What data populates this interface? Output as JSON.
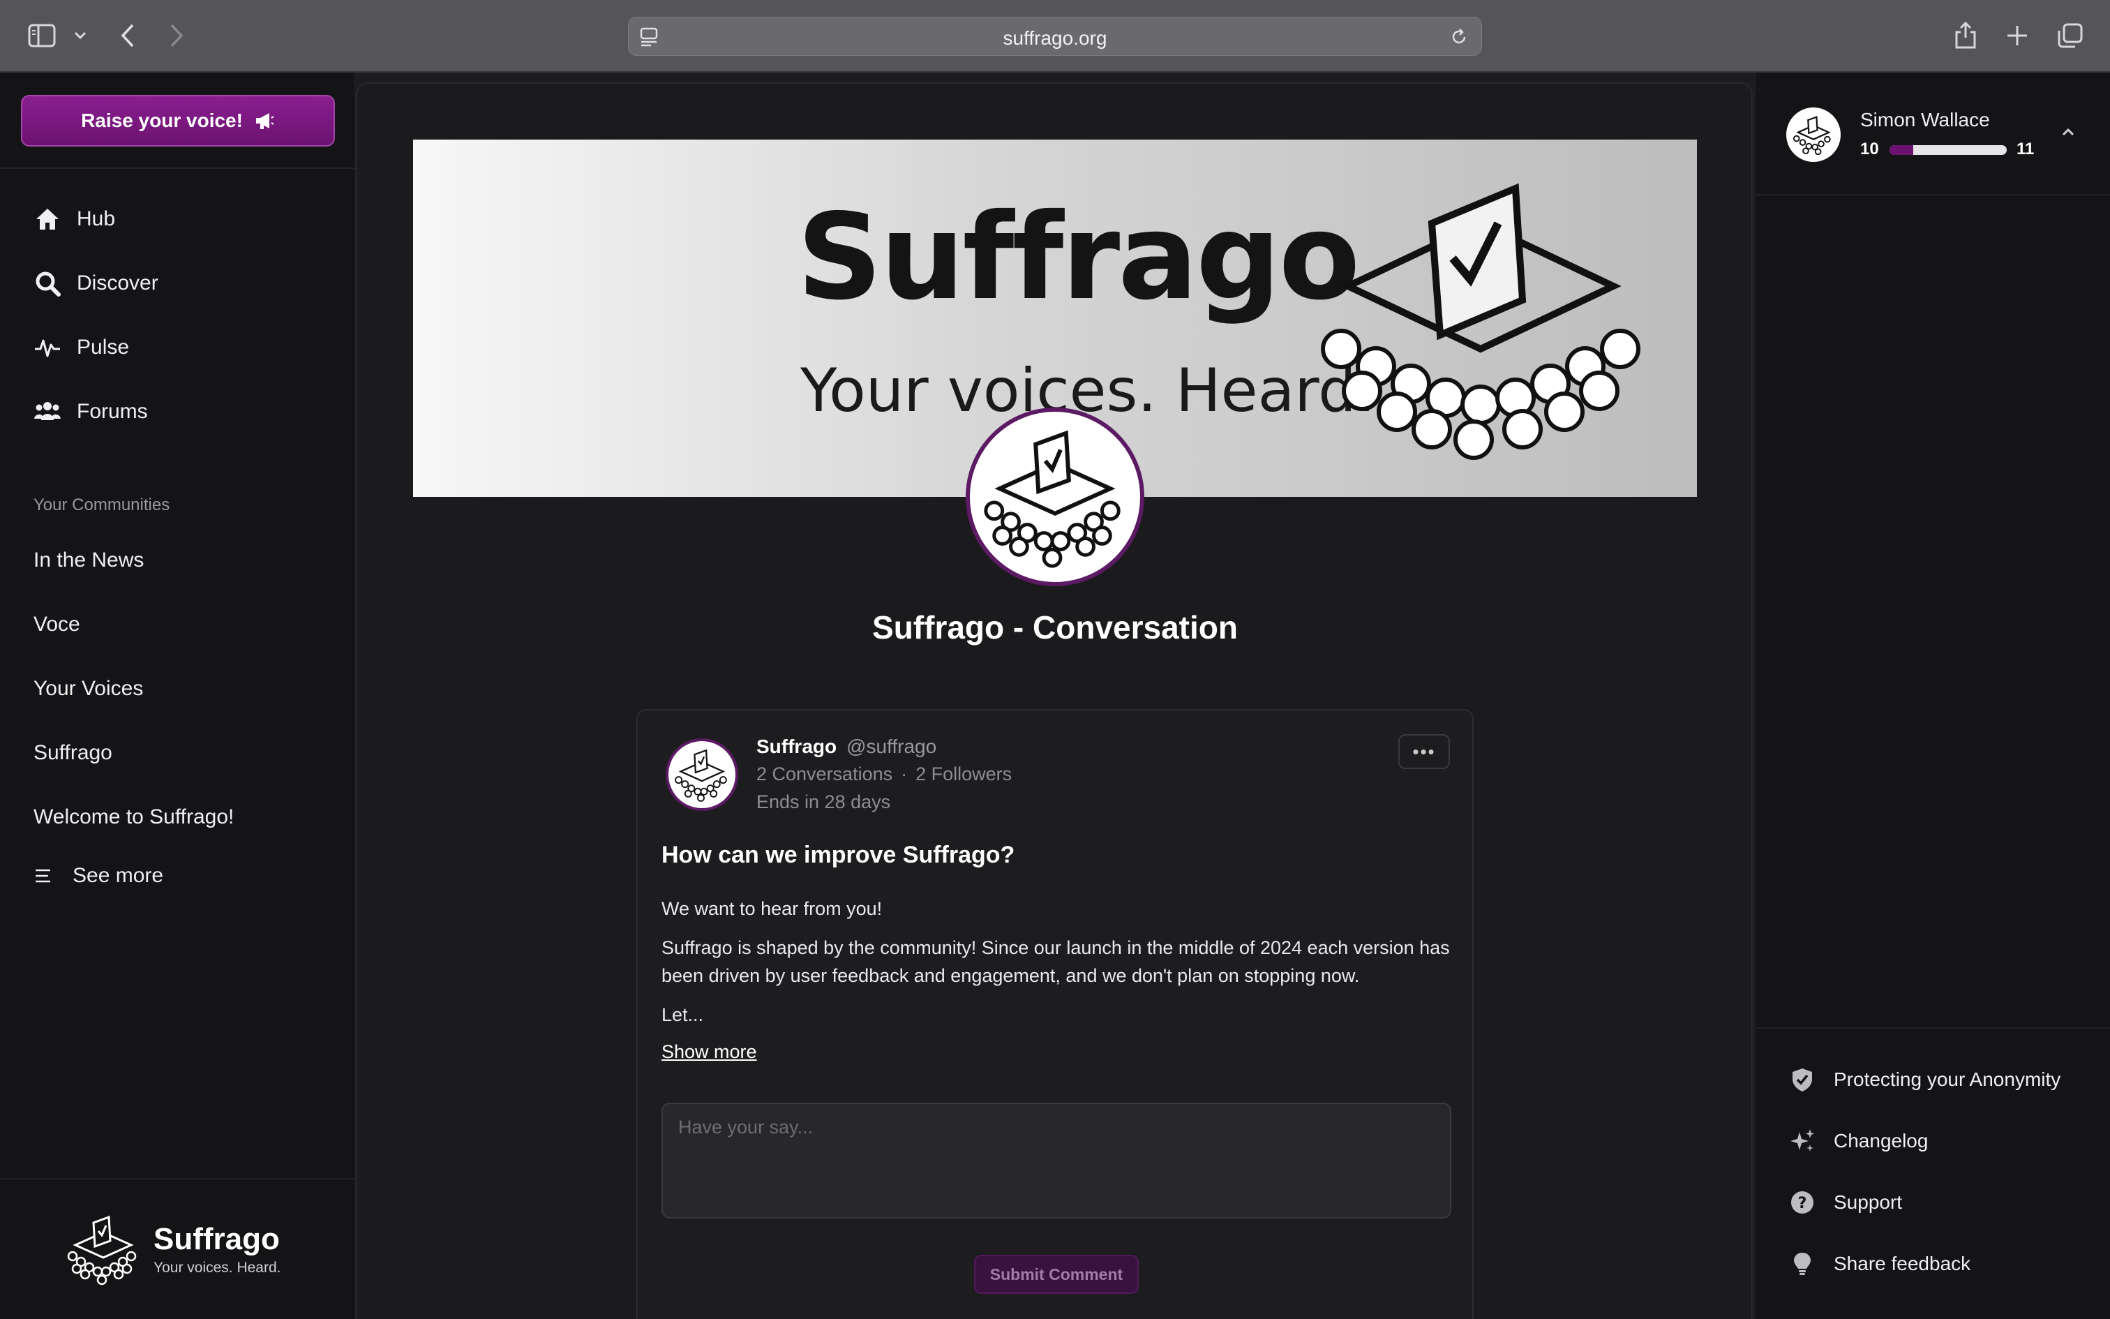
{
  "browser": {
    "url": "suffrago.org"
  },
  "sidebar": {
    "raise_button": "Raise your voice!",
    "nav": [
      {
        "label": "Hub",
        "icon": "home-icon"
      },
      {
        "label": "Discover",
        "icon": "search-icon"
      },
      {
        "label": "Pulse",
        "icon": "pulse-icon"
      },
      {
        "label": "Forums",
        "icon": "users-icon"
      }
    ],
    "communities_label": "Your Communities",
    "communities": [
      "In the News",
      "Voce",
      "Your Voices",
      "Suffrago",
      "Welcome to Suffrago!"
    ],
    "see_more": "See more",
    "brand": {
      "name": "Suffrago",
      "tagline": "Your voices. Heard."
    }
  },
  "banner": {
    "title": "Suffrago",
    "subtitle": "Your voices. Heard."
  },
  "main": {
    "title": "Suffrago - Conversation",
    "post": {
      "author": "Suffrago",
      "handle": "@suffrago",
      "conversations": "2 Conversations",
      "followers": "2 Followers",
      "ends": "Ends in 28 days",
      "more_label": "•••",
      "heading": "How can we improve Suffrago?",
      "para1": "We want to hear from you!",
      "para2": "Suffrago is shaped by the community! Since our launch in the middle of 2024 each version has been driven by user feedback and engagement, and we don't plan on stopping now.",
      "para3": "Let...",
      "show_more": "Show more",
      "comment_placeholder": "Have your say...",
      "submit": "Submit Comment"
    }
  },
  "right": {
    "user": {
      "name": "Simon Wallace",
      "level_current": "10",
      "level_next": "11",
      "progress": 0.2
    },
    "links": [
      {
        "label": "Protecting your Anonymity",
        "icon": "shield-check-icon"
      },
      {
        "label": "Changelog",
        "icon": "sparkles-icon"
      },
      {
        "label": "Support",
        "icon": "question-circle-icon"
      },
      {
        "label": "Share feedback",
        "icon": "lightbulb-icon"
      }
    ]
  },
  "colors": {
    "accent": "#6b1270",
    "background": "#1b1b1d",
    "sidebar": "#141416"
  }
}
